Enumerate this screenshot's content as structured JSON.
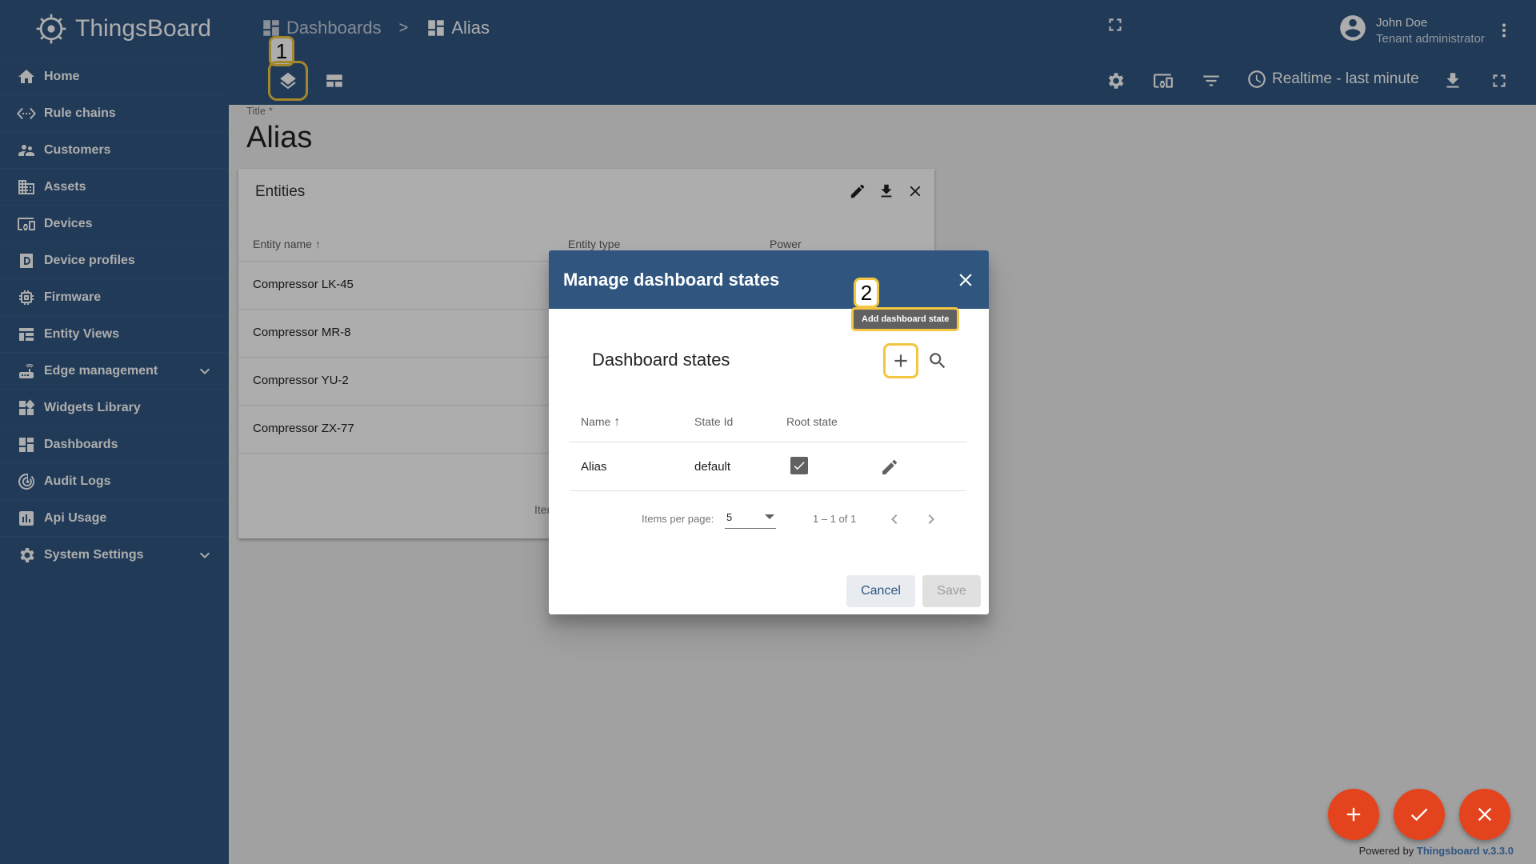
{
  "app": {
    "name": "ThingsBoard"
  },
  "sidebar": {
    "items": [
      {
        "label": "Home",
        "icon": "home-icon"
      },
      {
        "label": "Rule chains",
        "icon": "settings-ethernet-icon"
      },
      {
        "label": "Customers",
        "icon": "supervisor-account-icon"
      },
      {
        "label": "Assets",
        "icon": "domain-icon"
      },
      {
        "label": "Devices",
        "icon": "devices-other-icon"
      },
      {
        "label": "Device profiles",
        "icon": "device-profile-icon"
      },
      {
        "label": "Firmware",
        "icon": "memory-icon"
      },
      {
        "label": "Entity Views",
        "icon": "view-quilt-icon"
      },
      {
        "label": "Edge management",
        "icon": "router-icon",
        "expandable": true
      },
      {
        "label": "Widgets Library",
        "icon": "widgets-icon"
      },
      {
        "label": "Dashboards",
        "icon": "dashboard-icon"
      },
      {
        "label": "Audit Logs",
        "icon": "track-changes-icon"
      },
      {
        "label": "Api Usage",
        "icon": "insert-chart-icon"
      },
      {
        "label": "System Settings",
        "icon": "settings-icon",
        "expandable": true
      }
    ]
  },
  "header": {
    "breadcrumb": {
      "parent": "Dashboards",
      "separator": ">",
      "current": "Alias"
    },
    "user": {
      "name": "John Doe",
      "role": "Tenant administrator"
    },
    "time_window": "Realtime - last minute",
    "markers": {
      "first": "1",
      "second": "2"
    }
  },
  "dashboard": {
    "title_label": "Title *",
    "title": "Alias",
    "widget": {
      "title": "Entities",
      "columns": [
        "Entity name",
        "Entity type",
        "Power"
      ],
      "rows": [
        "Compressor LK-45",
        "Compressor MR-8",
        "Compressor YU-2",
        "Compressor ZX-77"
      ],
      "footer": "Item"
    }
  },
  "dialog": {
    "title": "Manage dashboard states",
    "section_title": "Dashboard states",
    "tooltip": "Add dashboard state",
    "columns": {
      "name": "Name",
      "state_id": "State Id",
      "root_state": "Root state"
    },
    "rows": [
      {
        "name": "Alias",
        "state_id": "default",
        "root": true
      }
    ],
    "paginator": {
      "items_label": "Items per page:",
      "page_size": "5",
      "range": "1 – 1 of 1"
    },
    "cancel_label": "Cancel",
    "save_label": "Save"
  },
  "footer": {
    "powered_prefix": "Powered by",
    "powered_link": "Thingsboard v.3.3.0"
  },
  "colors": {
    "primary": "#305680",
    "accent": "#e4441d",
    "highlight": "#f2c640"
  }
}
